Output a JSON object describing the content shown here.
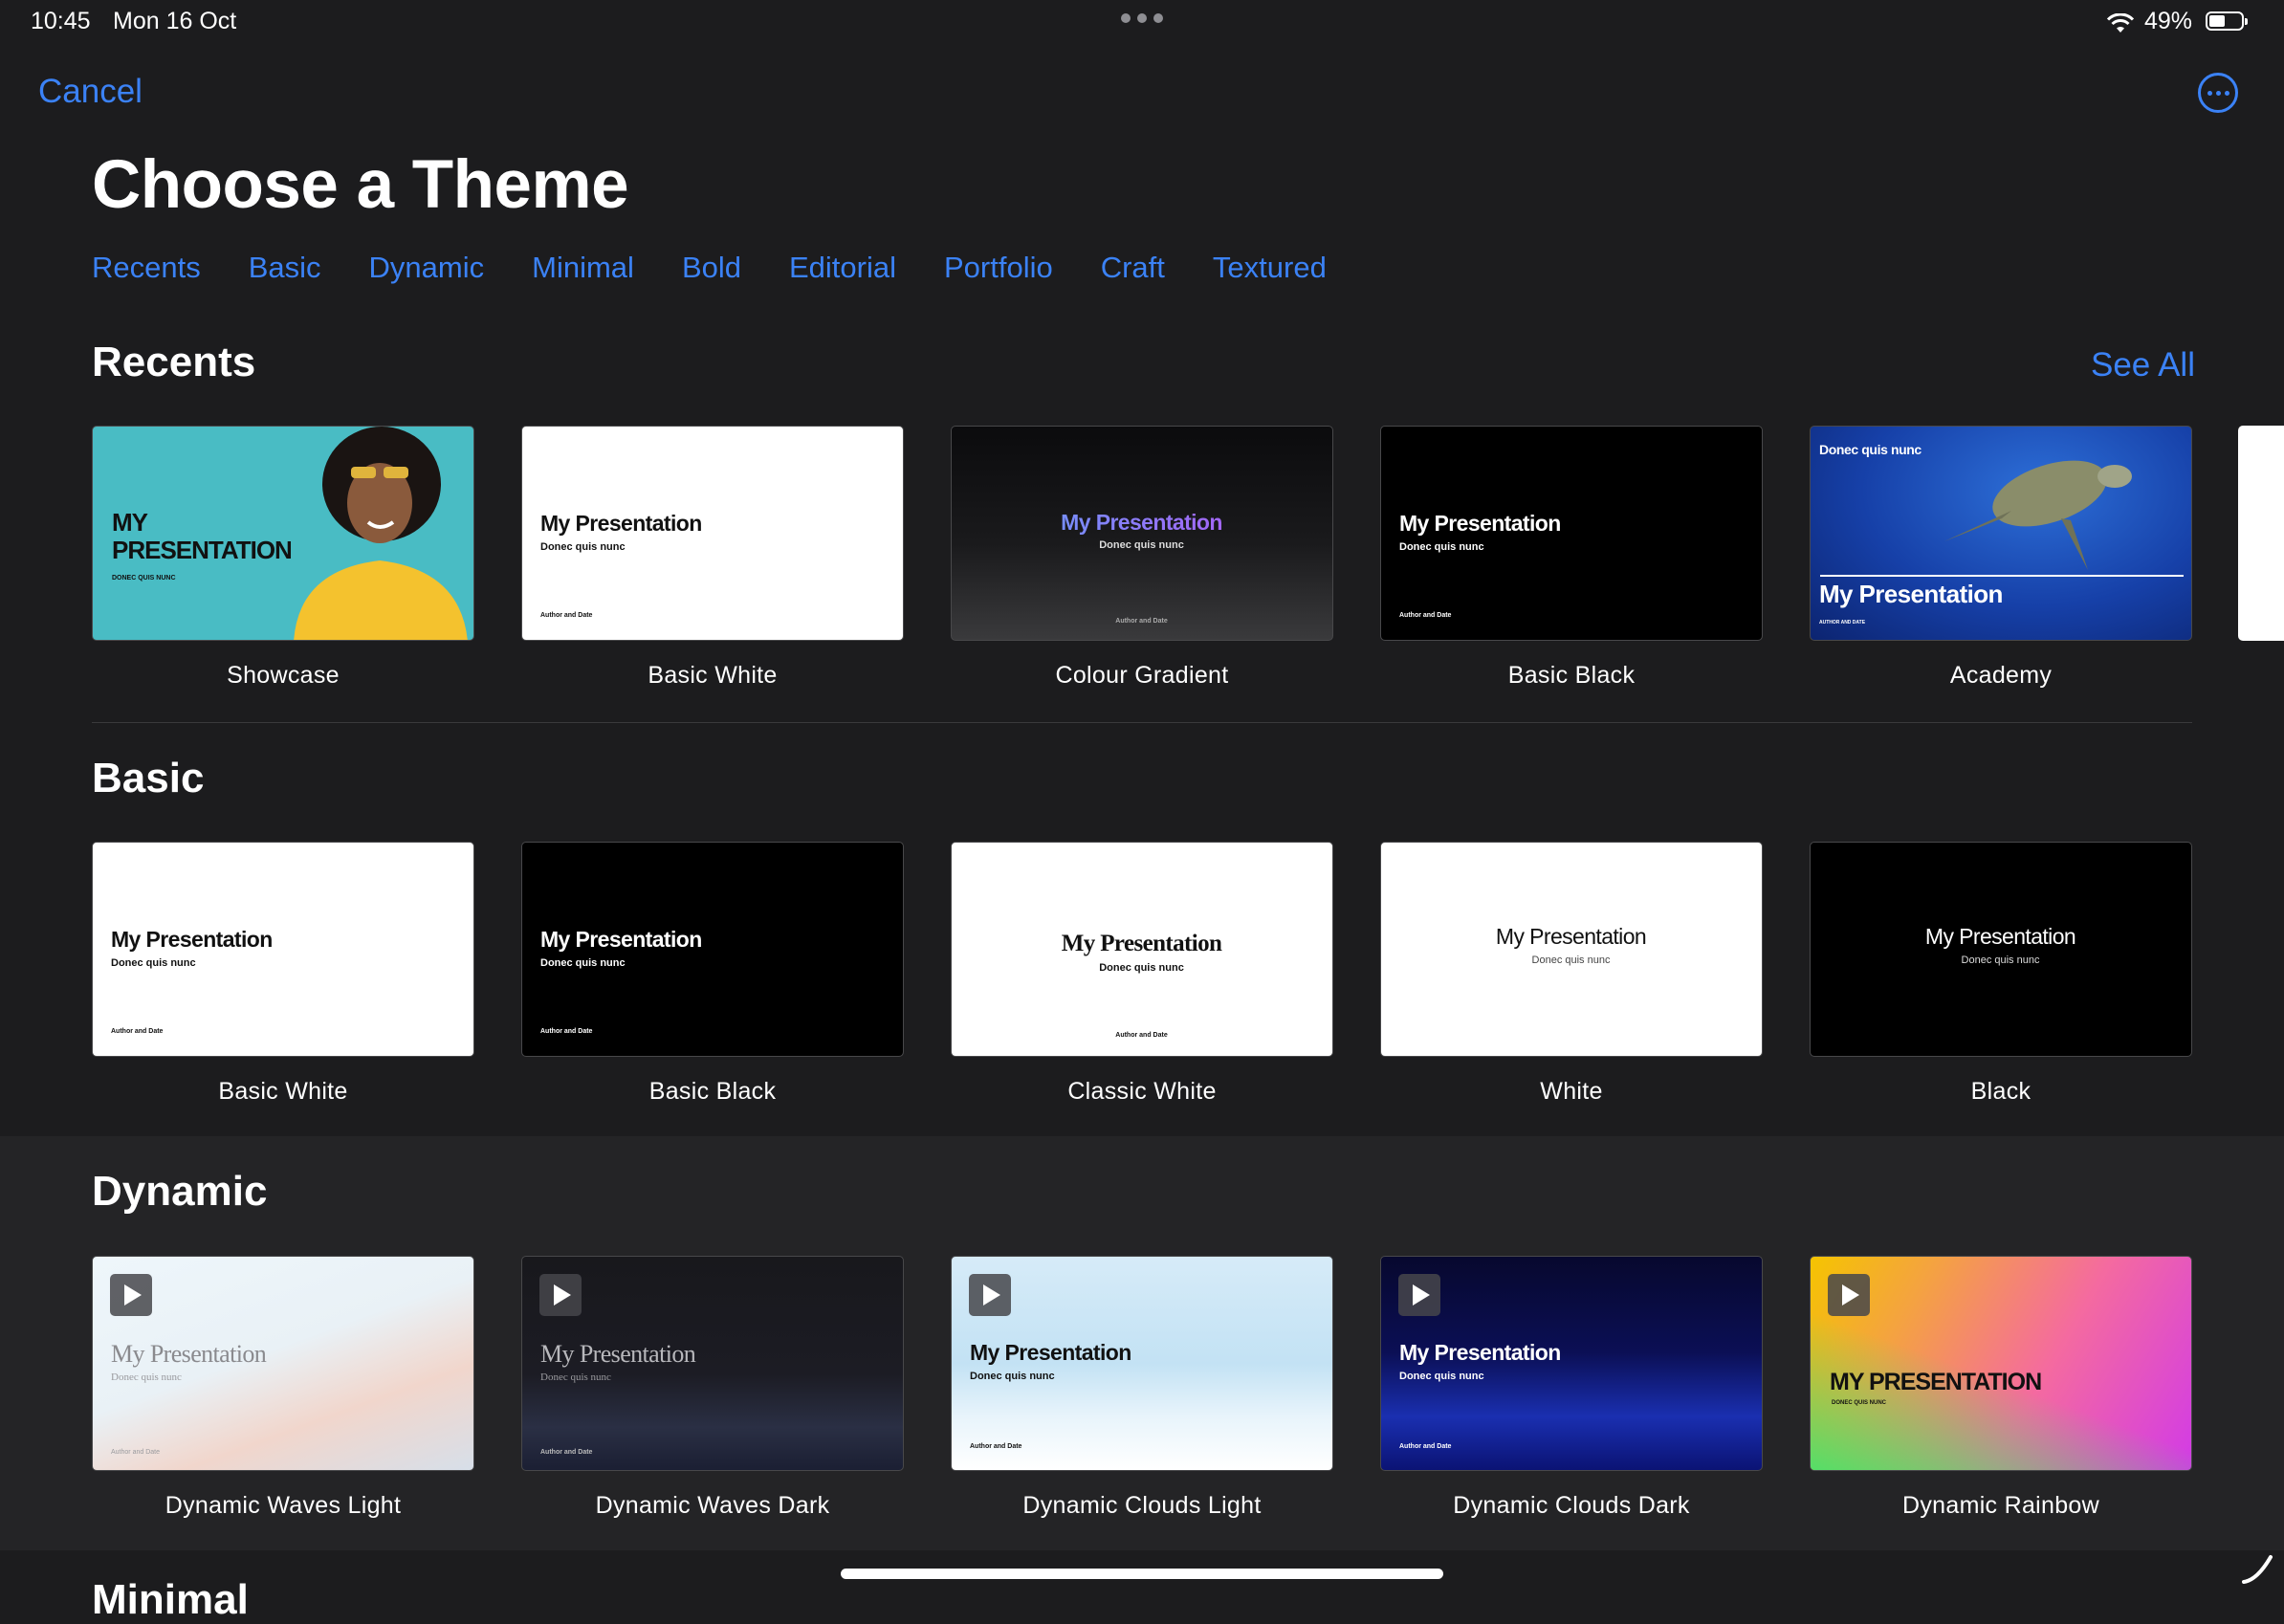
{
  "status": {
    "time": "10:45",
    "date": "Mon 16 Oct",
    "battery": "49%",
    "battery_level": 0.49
  },
  "nav": {
    "cancel": "Cancel"
  },
  "title": "Choose a Theme",
  "categories": [
    "Recents",
    "Basic",
    "Dynamic",
    "Minimal",
    "Bold",
    "Editorial",
    "Portfolio",
    "Craft",
    "Textured"
  ],
  "sections": {
    "recents": {
      "title": "Recents",
      "see_all": "See All",
      "items": [
        {
          "name": "Showcase",
          "title": "MY PRESENTATION",
          "subtitle": "DONEC QUIS NUNC"
        },
        {
          "name": "Basic White",
          "title": "My Presentation",
          "subtitle": "Donec quis nunc",
          "author": "Author and Date"
        },
        {
          "name": "Colour Gradient",
          "title": "My Presentation",
          "subtitle": "Donec quis nunc",
          "author": "Author and Date"
        },
        {
          "name": "Basic Black",
          "title": "My Presentation",
          "subtitle": "Donec quis nunc",
          "author": "Author and Date"
        },
        {
          "name": "Academy",
          "title": "My Presentation",
          "subtitle": "Donec quis nunc",
          "author": "AUTHOR AND DATE"
        }
      ]
    },
    "basic": {
      "title": "Basic",
      "items": [
        {
          "name": "Basic White",
          "title": "My Presentation",
          "subtitle": "Donec quis nunc",
          "author": "Author and Date"
        },
        {
          "name": "Basic Black",
          "title": "My Presentation",
          "subtitle": "Donec quis nunc",
          "author": "Author and Date"
        },
        {
          "name": "Classic White",
          "title": "My Presentation",
          "subtitle": "Donec quis nunc",
          "author": "Author and Date"
        },
        {
          "name": "White",
          "title": "My Presentation",
          "subtitle": "Donec quis nunc"
        },
        {
          "name": "Black",
          "title": "My Presentation",
          "subtitle": "Donec quis nunc"
        }
      ]
    },
    "dynamic": {
      "title": "Dynamic",
      "items": [
        {
          "name": "Dynamic Waves Light",
          "title": "My Presentation",
          "subtitle": "Donec quis nunc",
          "author": "Author and Date"
        },
        {
          "name": "Dynamic Waves Dark",
          "title": "My Presentation",
          "subtitle": "Donec quis nunc",
          "author": "Author and Date"
        },
        {
          "name": "Dynamic Clouds Light",
          "title": "My Presentation",
          "subtitle": "Donec quis nunc",
          "author": "Author and Date"
        },
        {
          "name": "Dynamic Clouds Dark",
          "title": "My Presentation",
          "subtitle": "Donec quis nunc",
          "author": "Author and Date"
        },
        {
          "name": "Dynamic Rainbow",
          "title": "MY PRESENTATION",
          "subtitle": "DONEC QUIS NUNC"
        }
      ]
    },
    "minimal": {
      "title": "Minimal"
    }
  },
  "icons": [
    "wifi-icon",
    "battery-icon",
    "more-options-icon",
    "play-icon",
    "multitasking-dots-icon"
  ],
  "colors": {
    "accent": "#3b82f6",
    "background": "#1c1c1e"
  }
}
